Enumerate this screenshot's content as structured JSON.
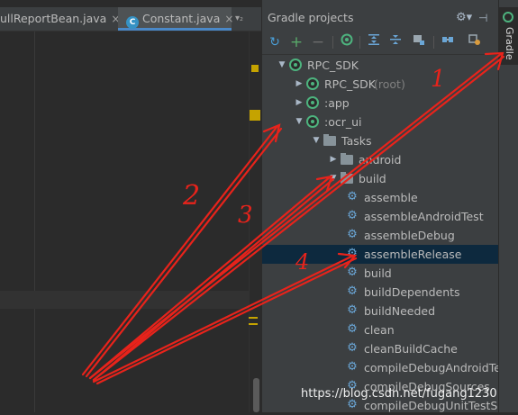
{
  "editor": {
    "tabs": [
      {
        "label": "ullReportBean.java",
        "close": "×"
      },
      {
        "label": "Constant.java",
        "icon_letter": "C",
        "close": "×"
      }
    ],
    "tab_overflow": "▾₂"
  },
  "gradle_panel": {
    "title": "Gradle projects",
    "gear": "⚙▾",
    "hide": "⊣"
  },
  "toolbar": {
    "icons": [
      "refresh-icon",
      "add-icon",
      "remove-icon",
      "execute-task-icon",
      "expand-all-icon",
      "collapse-all-icon",
      "group-modules-icon",
      "link-icon",
      "settings-icon"
    ]
  },
  "tree": [
    {
      "label": "RPC_SDK",
      "arrow": "▼",
      "icon": "gradle",
      "level": 0
    },
    {
      "label": "RPC_SDK",
      "sub": "(root)",
      "arrow": "▶",
      "icon": "gradle",
      "level": 1
    },
    {
      "label": ":app",
      "arrow": "▶",
      "icon": "gradle",
      "level": 1
    },
    {
      "label": ":ocr_ui",
      "arrow": "▼",
      "icon": "gradle",
      "level": 1
    },
    {
      "label": "Tasks",
      "arrow": "▼",
      "icon": "folder",
      "level": 2
    },
    {
      "label": "android",
      "arrow": "▶",
      "icon": "folder",
      "level": 3
    },
    {
      "label": "build",
      "arrow": "▼",
      "icon": "folder",
      "level": 3
    },
    {
      "label": "assemble",
      "icon": "gear",
      "level": 4
    },
    {
      "label": "assembleAndroidTest",
      "icon": "gear",
      "level": 4
    },
    {
      "label": "assembleDebug",
      "icon": "gear",
      "level": 4
    },
    {
      "label": "assembleRelease",
      "icon": "gear",
      "level": 4,
      "selected": true
    },
    {
      "label": "build",
      "icon": "gear",
      "level": 4
    },
    {
      "label": "buildDependents",
      "icon": "gear",
      "level": 4
    },
    {
      "label": "buildNeeded",
      "icon": "gear",
      "level": 4
    },
    {
      "label": "clean",
      "icon": "gear",
      "level": 4
    },
    {
      "label": "cleanBuildCache",
      "icon": "gear",
      "level": 4
    },
    {
      "label": "compileDebugAndroidTe",
      "icon": "gear",
      "level": 4
    },
    {
      "label": "compileDebugSources",
      "icon": "gear",
      "level": 4
    },
    {
      "label": "compileDebugUnitTestS",
      "icon": "gear",
      "level": 4
    }
  ],
  "tool_strip": {
    "label": "Gradle"
  },
  "annotations": {
    "numbers": [
      "1",
      "2",
      "3",
      "4"
    ],
    "color": "#e8231b"
  },
  "watermark": "https://blog.csdn.net/fugang1230"
}
